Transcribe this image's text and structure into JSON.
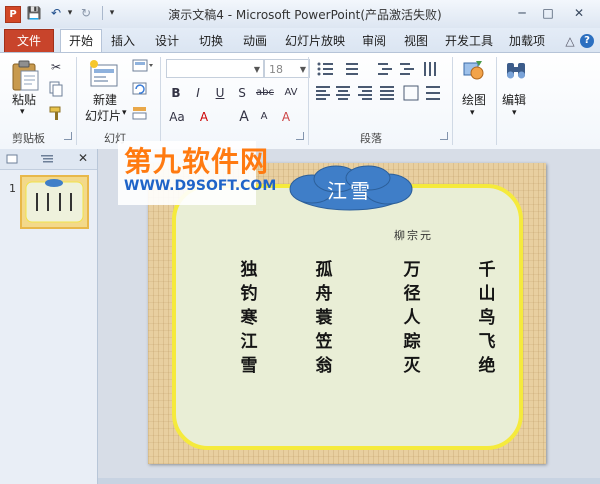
{
  "window": {
    "title": "演示文稿4 - Microsoft PowerPoint(产品激活失败)",
    "app_icon_letter": "P",
    "controls": {
      "minimize": "─",
      "maximize": "□",
      "close": "✕"
    }
  },
  "quick_access": {
    "save": "💾",
    "undo": "↶",
    "undo_dd": "▾",
    "redo": "↻",
    "more": "▾"
  },
  "ribbon_tabs": {
    "file": "文件",
    "items": [
      "开始",
      "插入",
      "设计",
      "切换",
      "动画",
      "幻灯片放映",
      "审阅",
      "视图",
      "开发工具",
      "加载项"
    ],
    "active_index": 0,
    "help_icons": {
      "collapse": "△",
      "help": "?"
    }
  },
  "home": {
    "clipboard": {
      "paste_label": "粘贴",
      "paste_dd": "▾",
      "group_label": "剪贴板"
    },
    "slides": {
      "new_slide_label_1": "新建",
      "new_slide_label_2": "幻灯片",
      "new_slide_dd": "▾",
      "group_label": "幻灯"
    },
    "font": {
      "font_name_value": "",
      "font_size_value": "18",
      "bold": "B",
      "italic": "I",
      "underline": "U",
      "shadow": "S",
      "strike": "abc",
      "spacing": "AV",
      "case": "Aa",
      "color": "A",
      "grow": "A",
      "shrink": "A",
      "clear": "A"
    },
    "paragraph": {
      "group_label": "段落"
    },
    "drawing": {
      "label": "绘图",
      "dd": "▾"
    },
    "editing": {
      "label": "编辑",
      "dd": "▾"
    }
  },
  "left_pane": {
    "close": "✕",
    "slide_number": "1"
  },
  "slide": {
    "title": "江雪",
    "author": "柳宗元",
    "poem_lines": [
      [
        "独",
        "钓",
        "寒",
        "江",
        "雪"
      ],
      [
        "孤",
        "舟",
        "蓑",
        "笠",
        "翁"
      ],
      [
        "万",
        "径",
        "人",
        "踪",
        "灭"
      ],
      [
        "千",
        "山",
        "鸟",
        "飞",
        "绝"
      ]
    ],
    "colors": {
      "cloud": "#3f7ec8",
      "panel_border": "#f5ea3c",
      "panel_fill": "#e9eed6",
      "background": "#e8cfa0"
    }
  },
  "watermark": {
    "logo": "第九软件网",
    "url": "WWW.D9SOFT.COM"
  },
  "colors": {
    "accent": "#c8442b",
    "ribbon_bg": "#dfe7f3"
  }
}
